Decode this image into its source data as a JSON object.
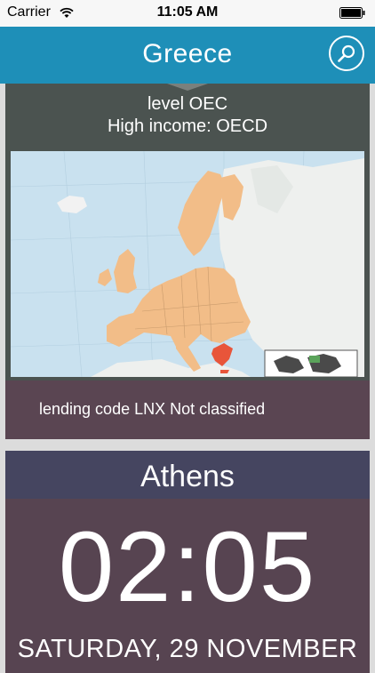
{
  "status_bar": {
    "carrier": "Carrier",
    "time": "11:05 AM"
  },
  "nav": {
    "title": "Greece",
    "search_icon": "search-icon"
  },
  "country_card": {
    "level_text": "level OEC",
    "income_text": "High income: OECD",
    "map": {
      "region": "Europe",
      "highlighted_country": "Greece",
      "highlight_color": "#e8553a",
      "eu_color": "#f2bd88",
      "water_color": "#c9e1ef"
    },
    "lending_text": "lending code LNX Not classified"
  },
  "city_card": {
    "city": "Athens",
    "time": "02:05",
    "date": "SATURDAY, 29 NOVEMBER"
  },
  "colors": {
    "nav_bar": "#1e8fb8",
    "country_card_bg": "#4b5350",
    "lending_strip": "#5a4552",
    "city_header": "#454560",
    "city_card_bg": "#574451"
  }
}
